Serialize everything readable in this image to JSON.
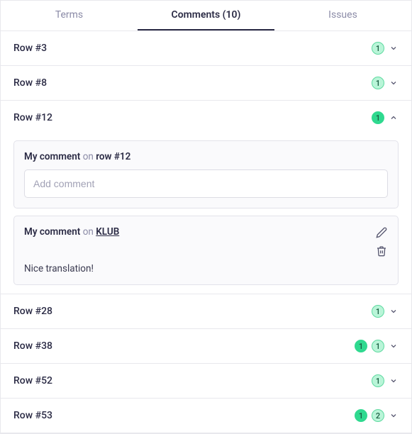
{
  "tabs": {
    "terms": "Terms",
    "comments": "Comments (10)",
    "issues": "Issues",
    "active": "comments"
  },
  "addComment": {
    "titlePrefix": "My comment",
    "titleOn": "on",
    "titleTarget": "row #12",
    "placeholder": "Add comment"
  },
  "existingComment": {
    "titlePrefix": "My comment",
    "titleOn": "on",
    "titleTarget": "KLUB",
    "body": "Nice translation!"
  },
  "rows": {
    "r3": {
      "label": "Row #3",
      "badges": [
        {
          "count": "1",
          "style": "light"
        }
      ],
      "expanded": false
    },
    "r8": {
      "label": "Row #8",
      "badges": [
        {
          "count": "1",
          "style": "light"
        }
      ],
      "expanded": false
    },
    "r12": {
      "label": "Row #12",
      "badges": [
        {
          "count": "1",
          "style": "solid"
        }
      ],
      "expanded": true
    },
    "r28": {
      "label": "Row #28",
      "badges": [
        {
          "count": "1",
          "style": "light"
        }
      ],
      "expanded": false
    },
    "r38": {
      "label": "Row #38",
      "badges": [
        {
          "count": "1",
          "style": "solid"
        },
        {
          "count": "1",
          "style": "light"
        }
      ],
      "expanded": false
    },
    "r52": {
      "label": "Row #52",
      "badges": [
        {
          "count": "1",
          "style": "light"
        }
      ],
      "expanded": false
    },
    "r53": {
      "label": "Row #53",
      "badges": [
        {
          "count": "1",
          "style": "solid"
        },
        {
          "count": "2",
          "style": "light"
        }
      ],
      "expanded": false
    }
  }
}
